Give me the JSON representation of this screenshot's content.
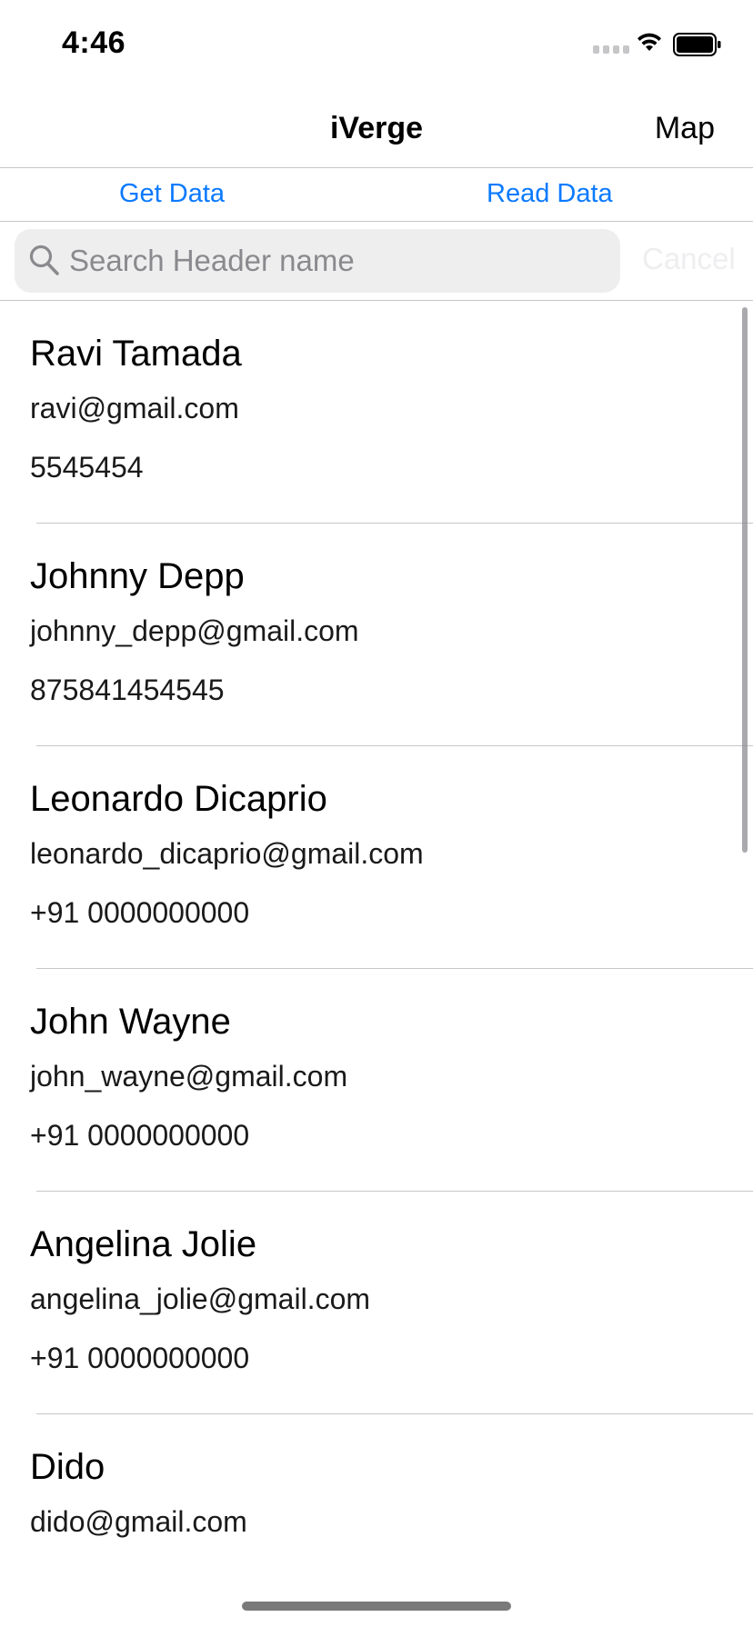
{
  "status_bar": {
    "time": "4:46"
  },
  "nav": {
    "title": "iVerge",
    "right_button": "Map"
  },
  "segments": {
    "get_data": "Get Data",
    "read_data": "Read Data"
  },
  "search": {
    "placeholder": "Search Header name",
    "value": "",
    "cancel": "Cancel"
  },
  "contacts": [
    {
      "name": "Ravi Tamada",
      "email": "ravi@gmail.com",
      "phone": "5545454"
    },
    {
      "name": "Johnny Depp",
      "email": "johnny_depp@gmail.com",
      "phone": "875841454545"
    },
    {
      "name": "Leonardo Dicaprio",
      "email": "leonardo_dicaprio@gmail.com",
      "phone": "+91 0000000000"
    },
    {
      "name": "John Wayne",
      "email": "john_wayne@gmail.com",
      "phone": "+91 0000000000"
    },
    {
      "name": "Angelina Jolie",
      "email": "angelina_jolie@gmail.com",
      "phone": "+91 0000000000"
    },
    {
      "name": "Dido",
      "email": "dido@gmail.com",
      "phone": ""
    }
  ],
  "colors": {
    "accent": "#0a7aff",
    "separator": "#c6c6c8",
    "search_bg": "#eeeeef"
  }
}
